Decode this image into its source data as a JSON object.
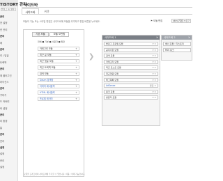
{
  "sidebar": {
    "title": "TISTORY 관리",
    "select": "블로그 홈 설정 선택",
    "items": [
      {
        "label": "관리",
        "section": true
      },
      {
        "label": "전 설정",
        "section": false
      },
      {
        "label": "년 관리",
        "section": false
      },
      {
        "label": "관리",
        "section": true
      },
      {
        "label": "레",
        "section": false
      },
      {
        "label": "관리",
        "section": true
      },
      {
        "label": "리 / 답글",
        "section": false
      },
      {
        "label": "트랙백",
        "section": false
      },
      {
        "label": "관리",
        "section": true
      },
      {
        "label": "에 플러그인",
        "section": false
      },
      {
        "label": "라이선스",
        "section": false
      },
      {
        "label": "관리",
        "section": true
      },
      {
        "label": "꾸미기",
        "section": false
      },
      {
        "label": "드 커버리",
        "section": false
      },
      {
        "label": "비 설정",
        "section": false
      },
      {
        "label": "관리",
        "section": true
      },
      {
        "label": "리 환경",
        "section": false
      },
      {
        "label": "통",
        "section": false
      },
      {
        "label": "관리",
        "section": true
      },
      {
        "label": "관리",
        "section": false
      },
      {
        "label": "설정",
        "section": true
      },
      {
        "label": "설정",
        "section": false
      },
      {
        "label": "관리",
        "section": false
      },
      {
        "label": "설정",
        "section": false
      }
    ]
  },
  "page": {
    "title": "사이드바",
    "tabs": [
      "사이드바",
      "위젯"
    ],
    "description": "모듈의 기능 또는 스타일 편집은 사이드바에 모듈을 추가하고 편집 버튼을 누르세요.",
    "tools": {
      "label": "모듈 편집",
      "select": "skin(기본) ▾",
      "help": "?"
    }
  },
  "modules": {
    "tab_default": "기본 모듈",
    "tab_html": "모듈 보관함",
    "filters": "전체   ■ 기본  ■ 사용자  ■ 확장",
    "items": [
      {
        "label": "카테고리 모듈",
        "highlight": false
      },
      {
        "label": "최근 글 모듈",
        "highlight": false
      },
      {
        "label": "최근 댓글 모듈",
        "highlight": false
      },
      {
        "label": "최근 트랙백 모듈",
        "highlight": false
      },
      {
        "label": "검색 모듈",
        "highlight": false
      },
      {
        "label": "Daum 검색창",
        "highlight": true
      },
      {
        "label": "이미지 배너출력",
        "highlight": true
      },
      {
        "label": "HTML 배너출력",
        "highlight": true
      },
      {
        "label": "프로필 레이어",
        "highlight": true
      }
    ],
    "add_label": "+",
    "hint": "모듈을 드래그하여 사이드바에 추가할 수 있습니다. 이동 / 삭제 가능합니다."
  },
  "columns": [
    {
      "title": "사이드바 1",
      "items": [
        {
          "label": "블로그 프로필 모듈",
          "control": "▾ ✕",
          "highlight": false
        },
        {
          "label": "공지사항 모듈",
          "control": "▾ ✕",
          "highlight": false
        },
        {
          "label": "검색 모듈",
          "control": "▾ ✕",
          "highlight": false
        },
        {
          "label": "카테고리 모듈",
          "control": "▾ ✕",
          "highlight": false
        },
        {
          "label": "최근 포스트 모듈",
          "control": "▾ ✕",
          "highlight": false
        },
        {
          "label": "최근댓글 모듈",
          "control": "▾ ✕",
          "highlight": false
        },
        {
          "label": "태그목록 모듈",
          "control": "▾ ✕",
          "highlight": false
        },
        {
          "label": "AdSense",
          "control": "편집 ✕",
          "highlight": true
        },
        {
          "label": "링크 모듈",
          "control": "▾ ✕",
          "highlight": false
        },
        {
          "label": "방문자 모듈",
          "control": "▾ ✕",
          "highlight": false
        }
      ]
    },
    {
      "title": "사이드바 2",
      "items": [
        {
          "label": "배너 모듈 : 티스토리",
          "control": "",
          "highlight": false
        },
        {
          "label": "RSS 링크",
          "control": "",
          "highlight": false
        }
      ]
    }
  ],
  "close_label": "✕",
  "colors": {
    "column_header": "#7a7f86",
    "link_blue": "#3a6cc7"
  }
}
